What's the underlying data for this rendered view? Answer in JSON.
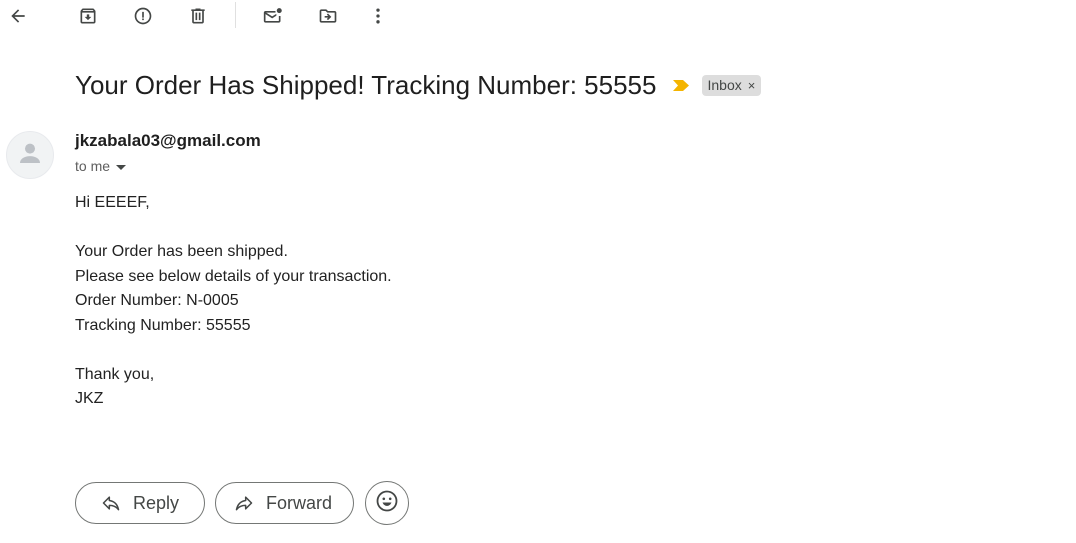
{
  "toolbar": {
    "items": [
      {
        "icon": "back-arrow-icon"
      },
      {
        "icon": "archive-icon"
      },
      {
        "icon": "report-spam-icon"
      },
      {
        "icon": "delete-icon"
      },
      {
        "icon": "mark-unread-icon"
      },
      {
        "icon": "move-to-icon"
      },
      {
        "icon": "more-vert-icon"
      }
    ]
  },
  "message": {
    "subject": "Your Order Has Shipped! Tracking Number: 55555",
    "importance_color": "#f4b400",
    "label": "Inbox",
    "label_remove": "×",
    "sender": "jkzabala03@gmail.com",
    "recipients": "to me",
    "body": {
      "greeting": "Hi EEEEF,",
      "line1": "Your Order has been shipped.",
      "line2": "Please see below details of your transaction.",
      "line3": "Order Number: N-0005",
      "line4": "Tracking Number: 55555",
      "closing": "Thank you,",
      "signature": "JKZ"
    }
  },
  "actions": {
    "reply": "Reply",
    "forward": "Forward",
    "emoji_icon": "emoji-icon"
  }
}
